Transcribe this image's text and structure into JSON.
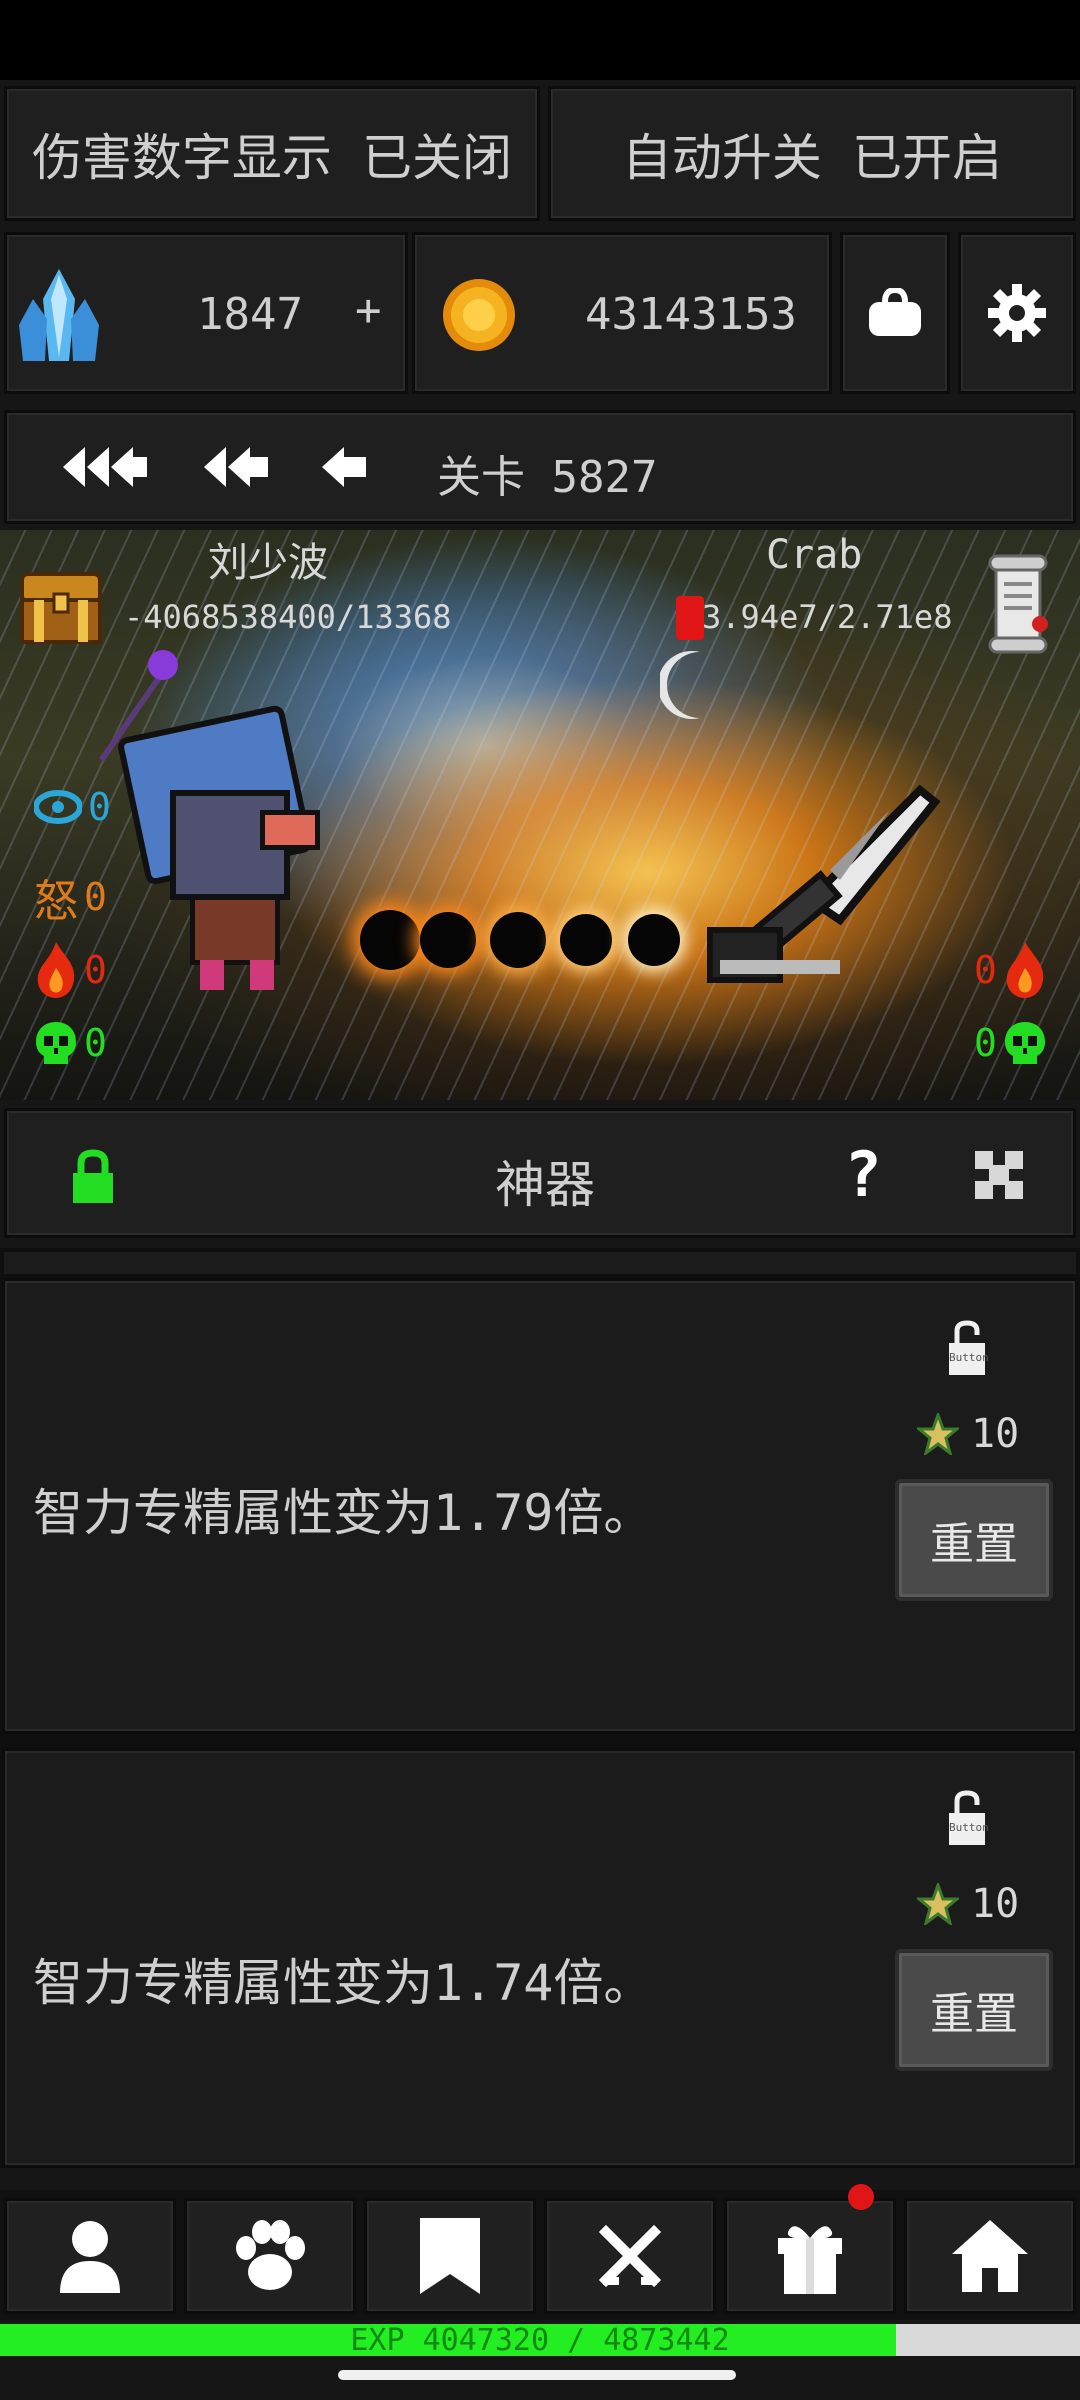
{
  "top_toggles": {
    "damage_display": "伤害数字显示 已关闭",
    "auto_upgrade": "自动升关 已开启"
  },
  "resources": {
    "crystals": "1847",
    "add_label": "+",
    "gold": "43143153"
  },
  "stage": {
    "label": "关卡 5827"
  },
  "battle": {
    "player_name": "刘少波",
    "player_hp": "-4068538400/13368",
    "enemy_name": "Crab",
    "enemy_hp": "3.94e7/2.71e8",
    "player_stats": {
      "eye": "0",
      "rage_label": "怒",
      "rage": "0",
      "fire": "0",
      "skull": "0"
    },
    "enemy_stats": {
      "fire": "0",
      "skull": "0"
    }
  },
  "artifact_panel": {
    "title": "神器",
    "help": "?",
    "items": [
      {
        "description": "智力专精属性变为1.79倍。",
        "cost": "10",
        "lock_label": "Button",
        "reset_label": "重置"
      },
      {
        "description": "智力专精属性变为1.74倍。",
        "cost": "10",
        "lock_label": "Button",
        "reset_label": "重置"
      }
    ]
  },
  "exp": {
    "text": "EXP 4047320 / 4873442",
    "progress": 0.83
  },
  "colors": {
    "exp_green": "#22ee22",
    "lock_green": "#22dd22",
    "badge_red": "#e01515"
  }
}
